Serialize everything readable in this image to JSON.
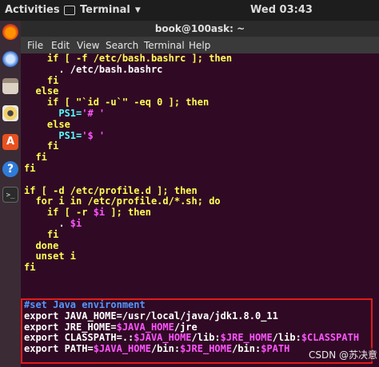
{
  "topbar": {
    "activities": "Activities",
    "app_name": "Terminal",
    "clock": "Wed 03:43"
  },
  "window": {
    "title": "book@100ask: ~"
  },
  "menu": {
    "file": "File",
    "edit": "Edit",
    "view": "View",
    "search": "Search",
    "terminal": "Terminal",
    "help": "Help"
  },
  "launcher": {
    "icons": [
      "firefox-icon",
      "thunderbird-icon",
      "files-icon",
      "rhythmbox-icon",
      "software-center-icon",
      "help-icon",
      "terminal-icon"
    ]
  },
  "code": {
    "l01a": "    if [ -f /etc/bash.bashrc ]; then",
    "l02": "      . /etc/bash.bashrc",
    "l03": "    fi",
    "l04": "  else",
    "l05a": "    if [ \"`id -u`\" -eq 0 ]; then",
    "l06a": "      PS1=",
    "l06b": "'# '",
    "l07": "    else",
    "l08a": "      PS1=",
    "l08b": "'$ '",
    "l09": "    fi",
    "l10": "  fi",
    "l11": "fi",
    "l13": "if [ -d /etc/profile.d ]; then",
    "l14": "  for i in /etc/profile.d/*.sh; do",
    "l15a": "    if [ -r ",
    "l15b": "$i",
    "l15c": " ]; then",
    "l16a": "      . ",
    "l16b": "$i",
    "l17": "    fi",
    "l18": "  done",
    "l19": "  unset i",
    "l20": "fi",
    "comment": "#set Java environment",
    "e1": "export JAVA_HOME=/usr/local/java/jdk1.8.0_11",
    "e2a": "export JRE_HOME=",
    "e2b": "$JAVA_HOME",
    "e2c": "/jre",
    "e3a": "export CLASSPATH=.:",
    "e3b": "$JAVA_HOME",
    "e3c": "/lib:",
    "e3d": "$JRE_HOME",
    "e3e": "/lib:",
    "e3f": "$CLASSPATH",
    "e4a": "export PATH=",
    "e4b": "$JAVA_HOME",
    "e4c": "/bin:",
    "e4d": "$JRE_HOME",
    "e4e": "/bin:",
    "e4f": "$PATH"
  },
  "watermark": "CSDN @苏决意",
  "colors": {
    "terminal_bg": "#300a24",
    "keyword": "#ffff54",
    "string": "#ff54ff",
    "variable": "#54ffff",
    "comment": "#5497ff",
    "highlight_box": "#e01b1b"
  }
}
